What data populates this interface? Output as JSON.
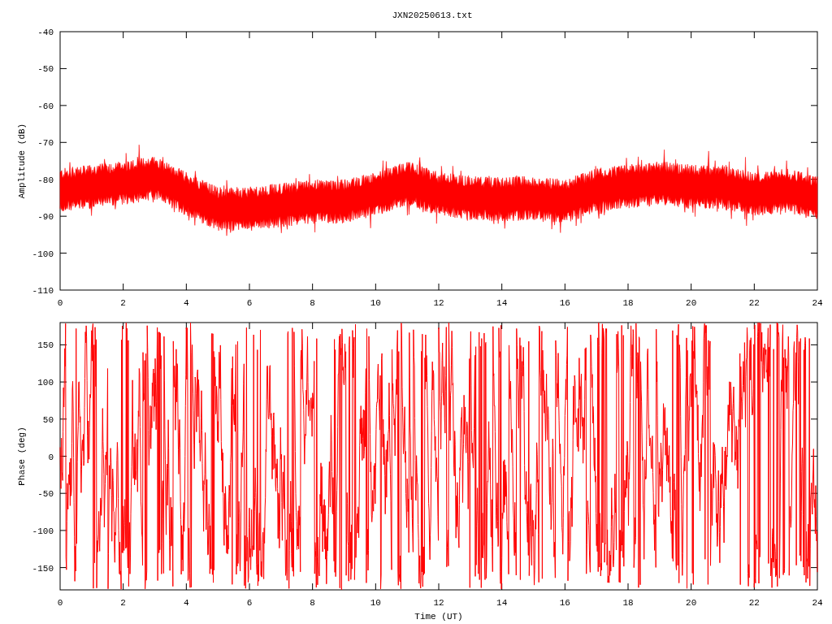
{
  "title": "JXN20250613.txt",
  "panels": [
    {
      "ylabel": "Amplitude (dB)",
      "yticks": [
        "-40",
        "-50",
        "-60",
        "-70",
        "-80",
        "-90",
        "-100",
        "-110"
      ],
      "xticks": [
        "0",
        "2",
        "4",
        "6",
        "8",
        "10",
        "12",
        "14",
        "16",
        "18",
        "20",
        "22",
        "24"
      ]
    },
    {
      "ylabel": "Phase (deg)",
      "yticks": [
        "150",
        "100",
        "50",
        "0",
        "-50",
        "-100",
        "-150"
      ],
      "xticks": [
        "0",
        "2",
        "4",
        "6",
        "8",
        "10",
        "12",
        "14",
        "16",
        "18",
        "20",
        "22",
        "24"
      ],
      "xlabel": "Time (UT)"
    }
  ]
}
